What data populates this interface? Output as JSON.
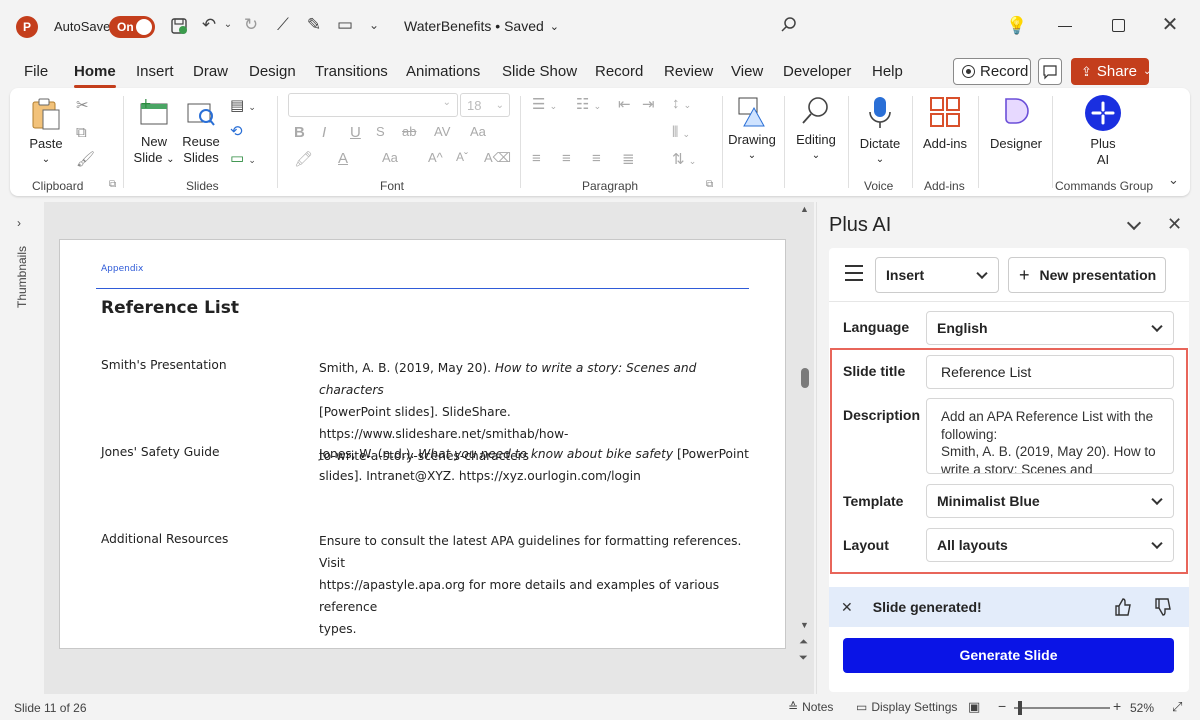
{
  "titlebar": {
    "autosave_label": "AutoSave",
    "autosave_state": "On",
    "doc_title": "WaterBenefits • Saved"
  },
  "tabs": [
    "File",
    "Home",
    "Insert",
    "Draw",
    "Design",
    "Transitions",
    "Animations",
    "Slide Show",
    "Record",
    "Review",
    "View",
    "Developer",
    "Help"
  ],
  "actions": {
    "record": "Record",
    "share": "Share"
  },
  "ribbon": {
    "clipboard": {
      "paste": "Paste",
      "label": "Clipboard"
    },
    "slides": {
      "new_slide_1": "New",
      "new_slide_2": "Slide",
      "reuse_1": "Reuse",
      "reuse_2": "Slides",
      "label": "Slides"
    },
    "font": {
      "size": "18",
      "label": "Font"
    },
    "paragraph": {
      "label": "Paragraph"
    },
    "drawing": {
      "label": "Drawing"
    },
    "editing": {
      "label": "Editing"
    },
    "voice": {
      "dictate": "Dictate",
      "label": "Voice"
    },
    "addins": {
      "addins": "Add-ins",
      "label": "Add-ins"
    },
    "designer": {
      "label": "Designer"
    },
    "plusai": {
      "line1": "Plus",
      "line2": "AI",
      "label": "Commands Group"
    }
  },
  "thumbnails_label": "Thumbnails",
  "slide": {
    "header": "Appendix",
    "title": "Reference List",
    "rows": [
      {
        "label": "Smith's Presentation",
        "line1_a": "Smith, A. B. (2019, May 20). ",
        "line1_i": "How to write a story: Scenes and characters",
        "line2": "[PowerPoint slides]. SlideShare. https://www.slideshare.net/smithab/how-",
        "line3": "to-write-a-story-scenes-characters"
      },
      {
        "label": "Jones' Safety Guide",
        "line1_a": "Jones, W. (n.d.). ",
        "line1_i": "What you need to know about bike safety",
        "line1_b": " [PowerPoint",
        "line2": "slides]. Intranet@XYZ. https://xyz.ourlogin.com/login"
      },
      {
        "label": "Additional Resources",
        "line1": "Ensure to consult the latest APA guidelines for formatting references. Visit",
        "line2": "https://apastyle.apa.org for more details and examples of various reference",
        "line3": "types."
      }
    ]
  },
  "panel": {
    "title": "Plus AI",
    "insert_dropdown": "Insert",
    "new_presentation": "New presentation",
    "language_label": "Language",
    "language_value": "English",
    "slide_title_label": "Slide title",
    "slide_title_value": "Reference List",
    "description_label": "Description",
    "description_value": "Add an APA Reference List with the following:\nSmith, A. B. (2019, May 20). How to write a story: Scenes and",
    "template_label": "Template",
    "template_value": "Minimalist Blue",
    "layout_label": "Layout",
    "layout_value": "All layouts",
    "toast": "Slide generated!",
    "generate_button": "Generate Slide",
    "colors": {
      "highlight": "#e8655a",
      "generate": "#0a14e6",
      "toast_bg": "#e3ecfa"
    }
  },
  "statusbar": {
    "slide_counter": "Slide 11 of 26",
    "notes": "Notes",
    "display_settings": "Display Settings",
    "zoom": "52%",
    "zoom_level": 0.52
  },
  "colors": {
    "accent": "#c43e1c",
    "slide_header": "#2f5bd8"
  }
}
